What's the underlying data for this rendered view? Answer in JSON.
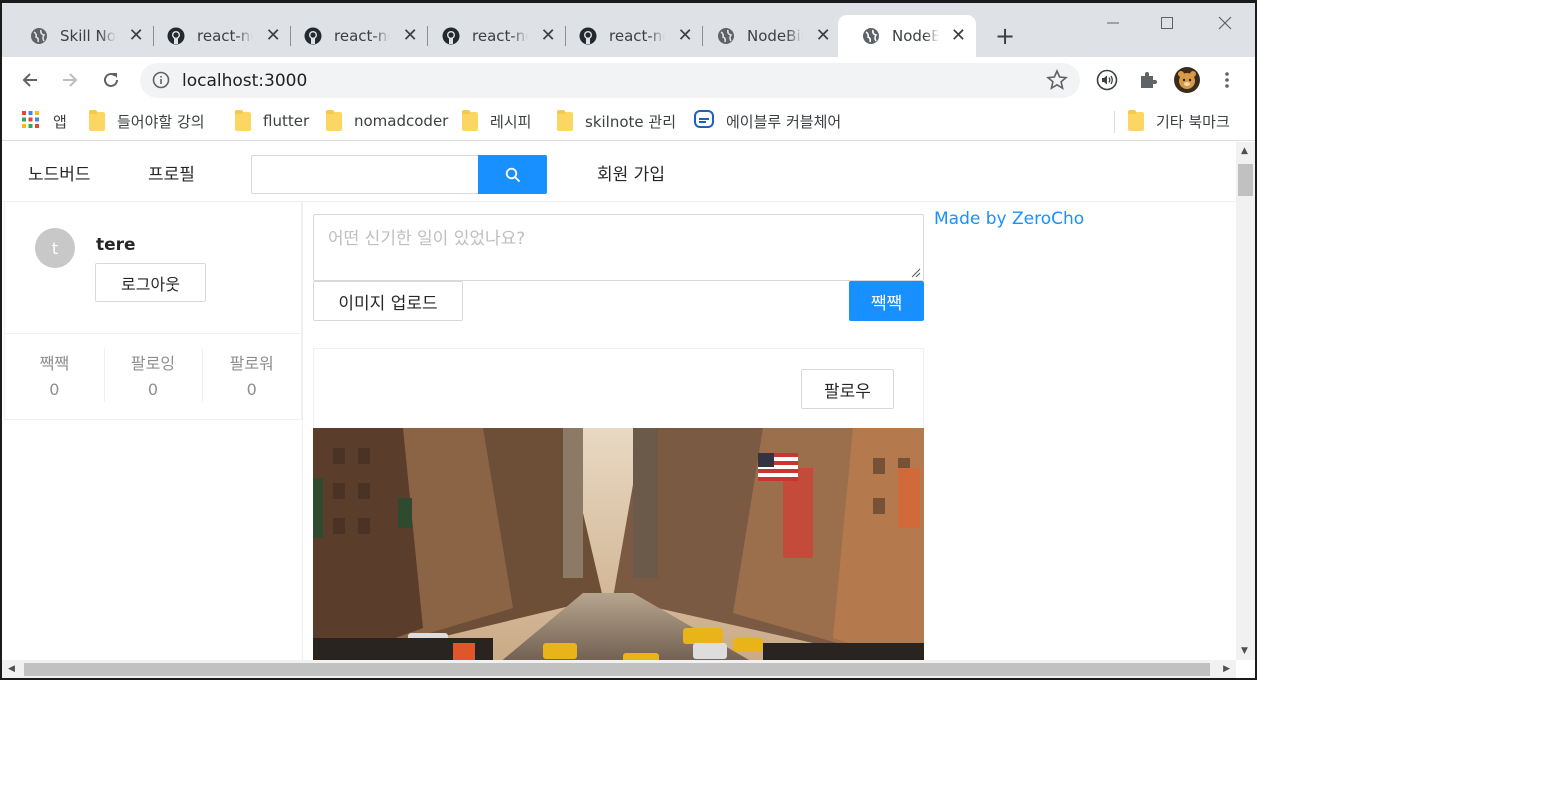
{
  "browser": {
    "tabs": [
      {
        "title": "Skill Note",
        "icon": "globe-icon",
        "active": false
      },
      {
        "title": "react-nodebird",
        "icon": "github-icon",
        "active": false
      },
      {
        "title": "react-nodebird",
        "icon": "github-icon",
        "active": false
      },
      {
        "title": "react-nodebird",
        "icon": "github-icon",
        "active": false
      },
      {
        "title": "react-nodebird",
        "icon": "github-icon",
        "active": false
      },
      {
        "title": "NodeBird",
        "icon": "globe-icon",
        "active": false
      },
      {
        "title": "NodeBird",
        "icon": "globe-icon",
        "active": true
      }
    ],
    "address": "localhost:3000",
    "bookmarks": [
      {
        "label": "앱",
        "icon": "apps-grid-icon"
      },
      {
        "label": "들어야할 강의",
        "icon": "folder-icon"
      },
      {
        "label": "flutter",
        "icon": "folder-icon"
      },
      {
        "label": "nomadcoder",
        "icon": "folder-icon"
      },
      {
        "label": "레시피",
        "icon": "folder-icon"
      },
      {
        "label": "skilnote 관리",
        "icon": "folder-icon"
      },
      {
        "label": "에이블루 커블체어",
        "icon": "ablue-logo-icon"
      }
    ],
    "other_bookmarks": "기타 북마크"
  },
  "page": {
    "menu": {
      "home": "노드버드",
      "profile": "프로필",
      "signup": "회원 가입"
    },
    "user": {
      "avatar_letter": "t",
      "nickname": "tere",
      "logout": "로그아웃"
    },
    "stats": [
      {
        "label": "짹짹",
        "value": "0"
      },
      {
        "label": "팔로잉",
        "value": "0"
      },
      {
        "label": "팔로워",
        "value": "0"
      }
    ],
    "post_form": {
      "placeholder": "어떤 신기한 일이 있었나요?",
      "upload": "이미지 업로드",
      "submit": "짹짹"
    },
    "post": {
      "follow": "팔로우",
      "image": "city-street-photo"
    },
    "made_by": "Made by ZeroCho"
  },
  "colors": {
    "primary": "#1890ff",
    "tabstrip": "#dee1e6"
  }
}
